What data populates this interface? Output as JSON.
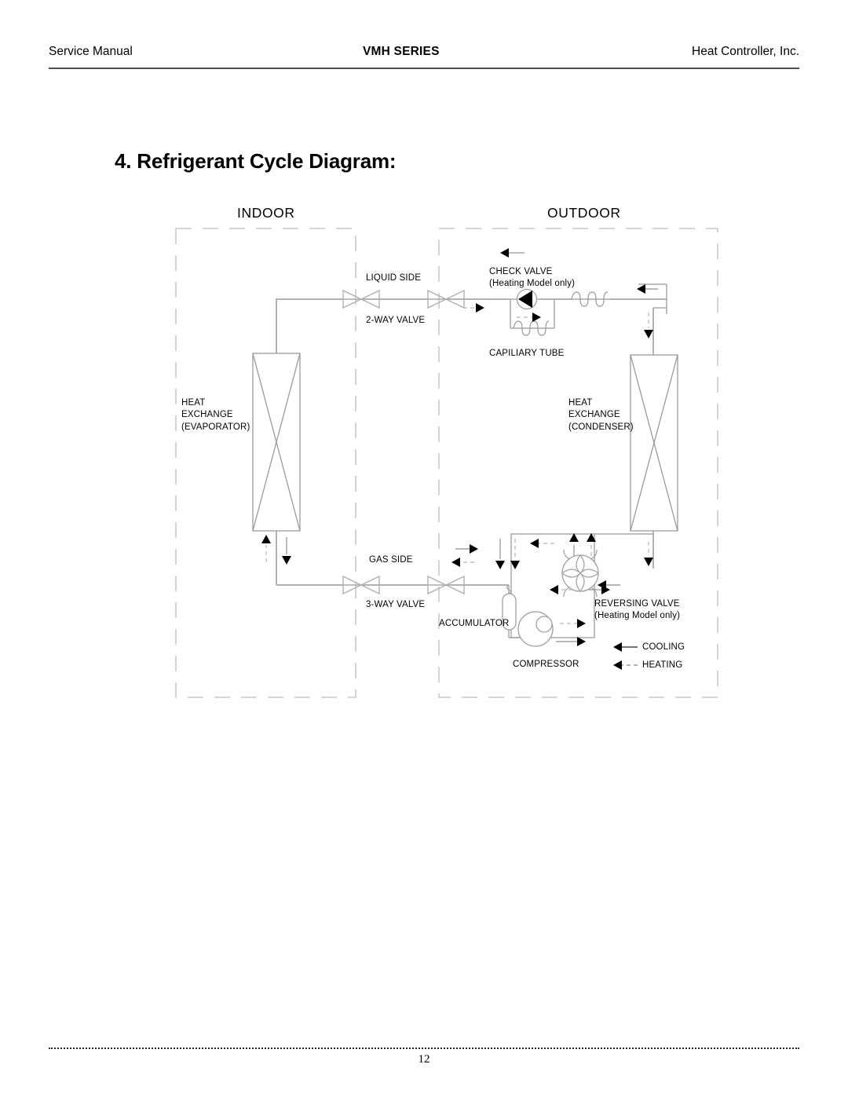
{
  "header": {
    "left": "Service Manual",
    "center": "VMH SERIES",
    "right": "Heat Controller, Inc."
  },
  "section": {
    "title": "4. Refrigerant Cycle Diagram:"
  },
  "diagram": {
    "zones": {
      "indoor": "INDOOR",
      "outdoor": "OUTDOOR"
    },
    "labels": {
      "liquid_side": "LIQUID SIDE",
      "two_way_valve": "2-WAY VALVE",
      "check_valve": "CHECK VALVE",
      "check_valve_note": "(Heating Model only)",
      "capillary_tube": "CAPILIARY TUBE",
      "heat_exchange_indoor_l1": "HEAT",
      "heat_exchange_indoor_l2": "EXCHANGE",
      "heat_exchange_indoor_l3": "(EVAPORATOR)",
      "heat_exchange_outdoor_l1": "HEAT",
      "heat_exchange_outdoor_l2": "EXCHANGE",
      "heat_exchange_outdoor_l3": "(CONDENSER)",
      "gas_side": "GAS SIDE",
      "three_way_valve": "3-WAY VALVE",
      "accumulator": "ACCUMULATOR",
      "reversing_valve": "REVERSING VALVE",
      "reversing_valve_note": "(Heating Model only)",
      "compressor": "COMPRESSOR"
    },
    "legend": {
      "cooling": "COOLING",
      "heating": "HEATING"
    },
    "colors": {
      "pipe": "#a8a8a8",
      "zone_border": "#c9c9c9",
      "arrow": "#000000",
      "text": "#000000"
    }
  },
  "footer": {
    "page_number": "12"
  }
}
